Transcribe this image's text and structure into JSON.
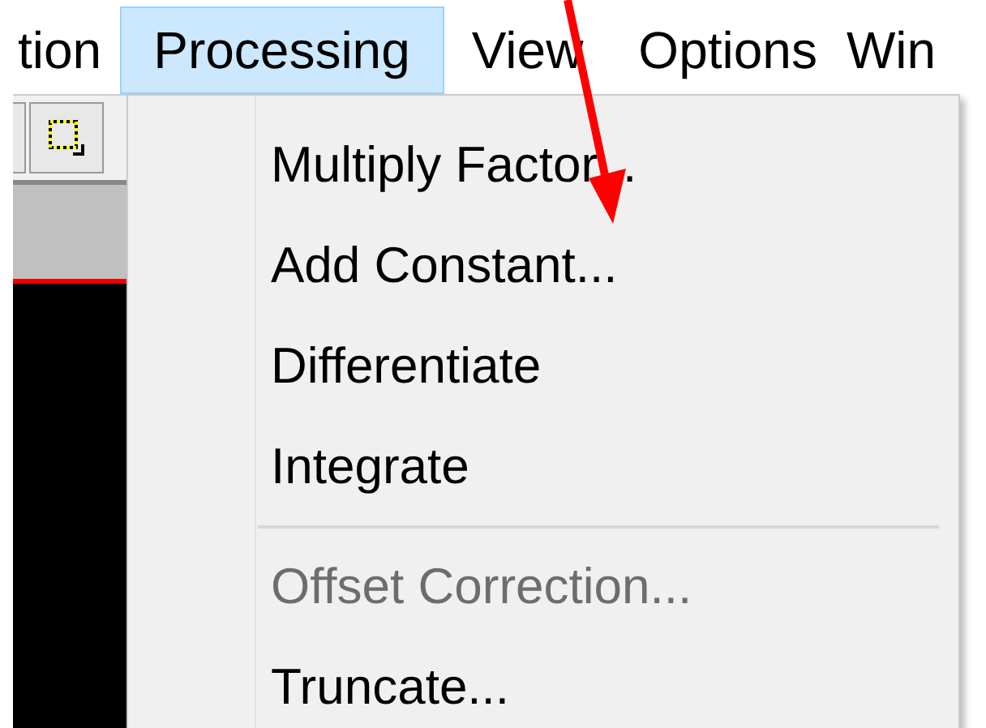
{
  "menu_bar": [
    {
      "label": "tion",
      "selected": false
    },
    {
      "label": "Processing",
      "selected": true
    },
    {
      "label": "View",
      "selected": false
    },
    {
      "label": "Options",
      "selected": false
    },
    {
      "label": "Win",
      "selected": false
    }
  ],
  "processing_menu": [
    {
      "kind": "item",
      "label": "Multiply Factor...",
      "disabled": false
    },
    {
      "kind": "item",
      "label": "Add Constant...",
      "disabled": false
    },
    {
      "kind": "item",
      "label": "Differentiate",
      "disabled": false
    },
    {
      "kind": "item",
      "label": "Integrate",
      "disabled": false
    },
    {
      "kind": "separator"
    },
    {
      "kind": "item",
      "label": "Offset Correction...",
      "disabled": true
    },
    {
      "kind": "item",
      "label": "Truncate...",
      "disabled": false
    }
  ]
}
